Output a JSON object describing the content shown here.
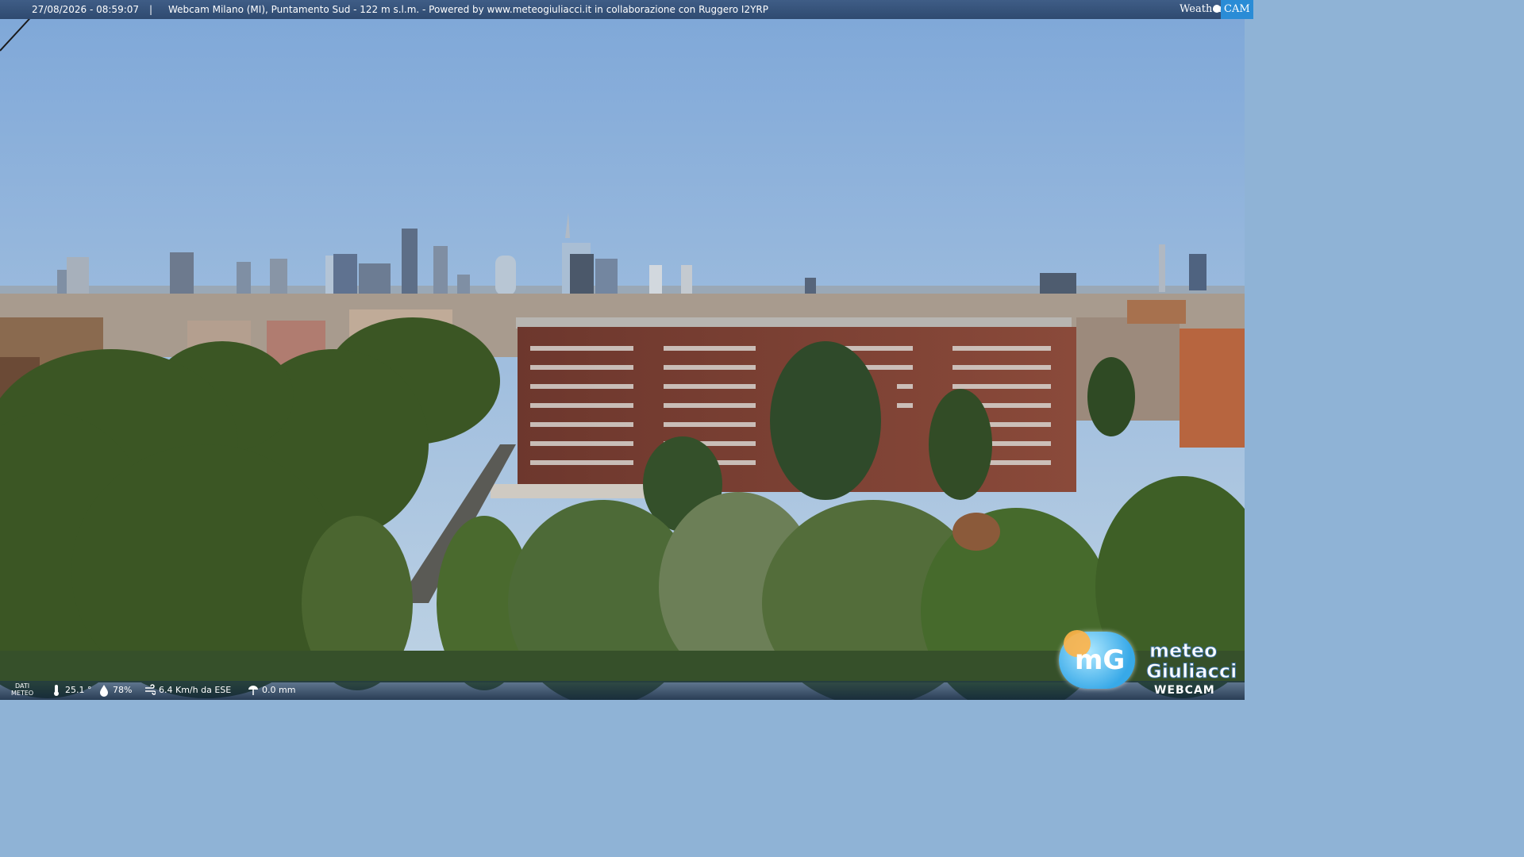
{
  "header": {
    "timestamp": "27/08/2026 - 08:59:07",
    "separator": "|",
    "caption": "Webcam Milano (MI), Puntamento Sud - 122 m s.l.m. - Powered by www.meteogiuliacci.it in collaborazione con Ruggero I2YRP"
  },
  "brand": {
    "weather": "Weather",
    "cam": "CAM"
  },
  "footer": {
    "dati_line1": "DATI",
    "dati_line2": "METEO",
    "temperature": "25.1 °",
    "humidity": "78%",
    "wind": "6.4 Km/h da ESE",
    "rain": "0.0 mm",
    "icons": [
      "thermometer-icon",
      "humidity-icon",
      "wind-icon",
      "rain-icon"
    ]
  },
  "logo": {
    "mark": "mG",
    "line1": "meteo",
    "line2": "Giuliacci",
    "line3": "WEBCAM"
  },
  "colors": {
    "sky_top": "#7fa8d8",
    "sky_bottom": "#b9cfe3",
    "foliage": "#3d5a24",
    "building": "#7a3f33",
    "bar": "#2f4a70"
  }
}
